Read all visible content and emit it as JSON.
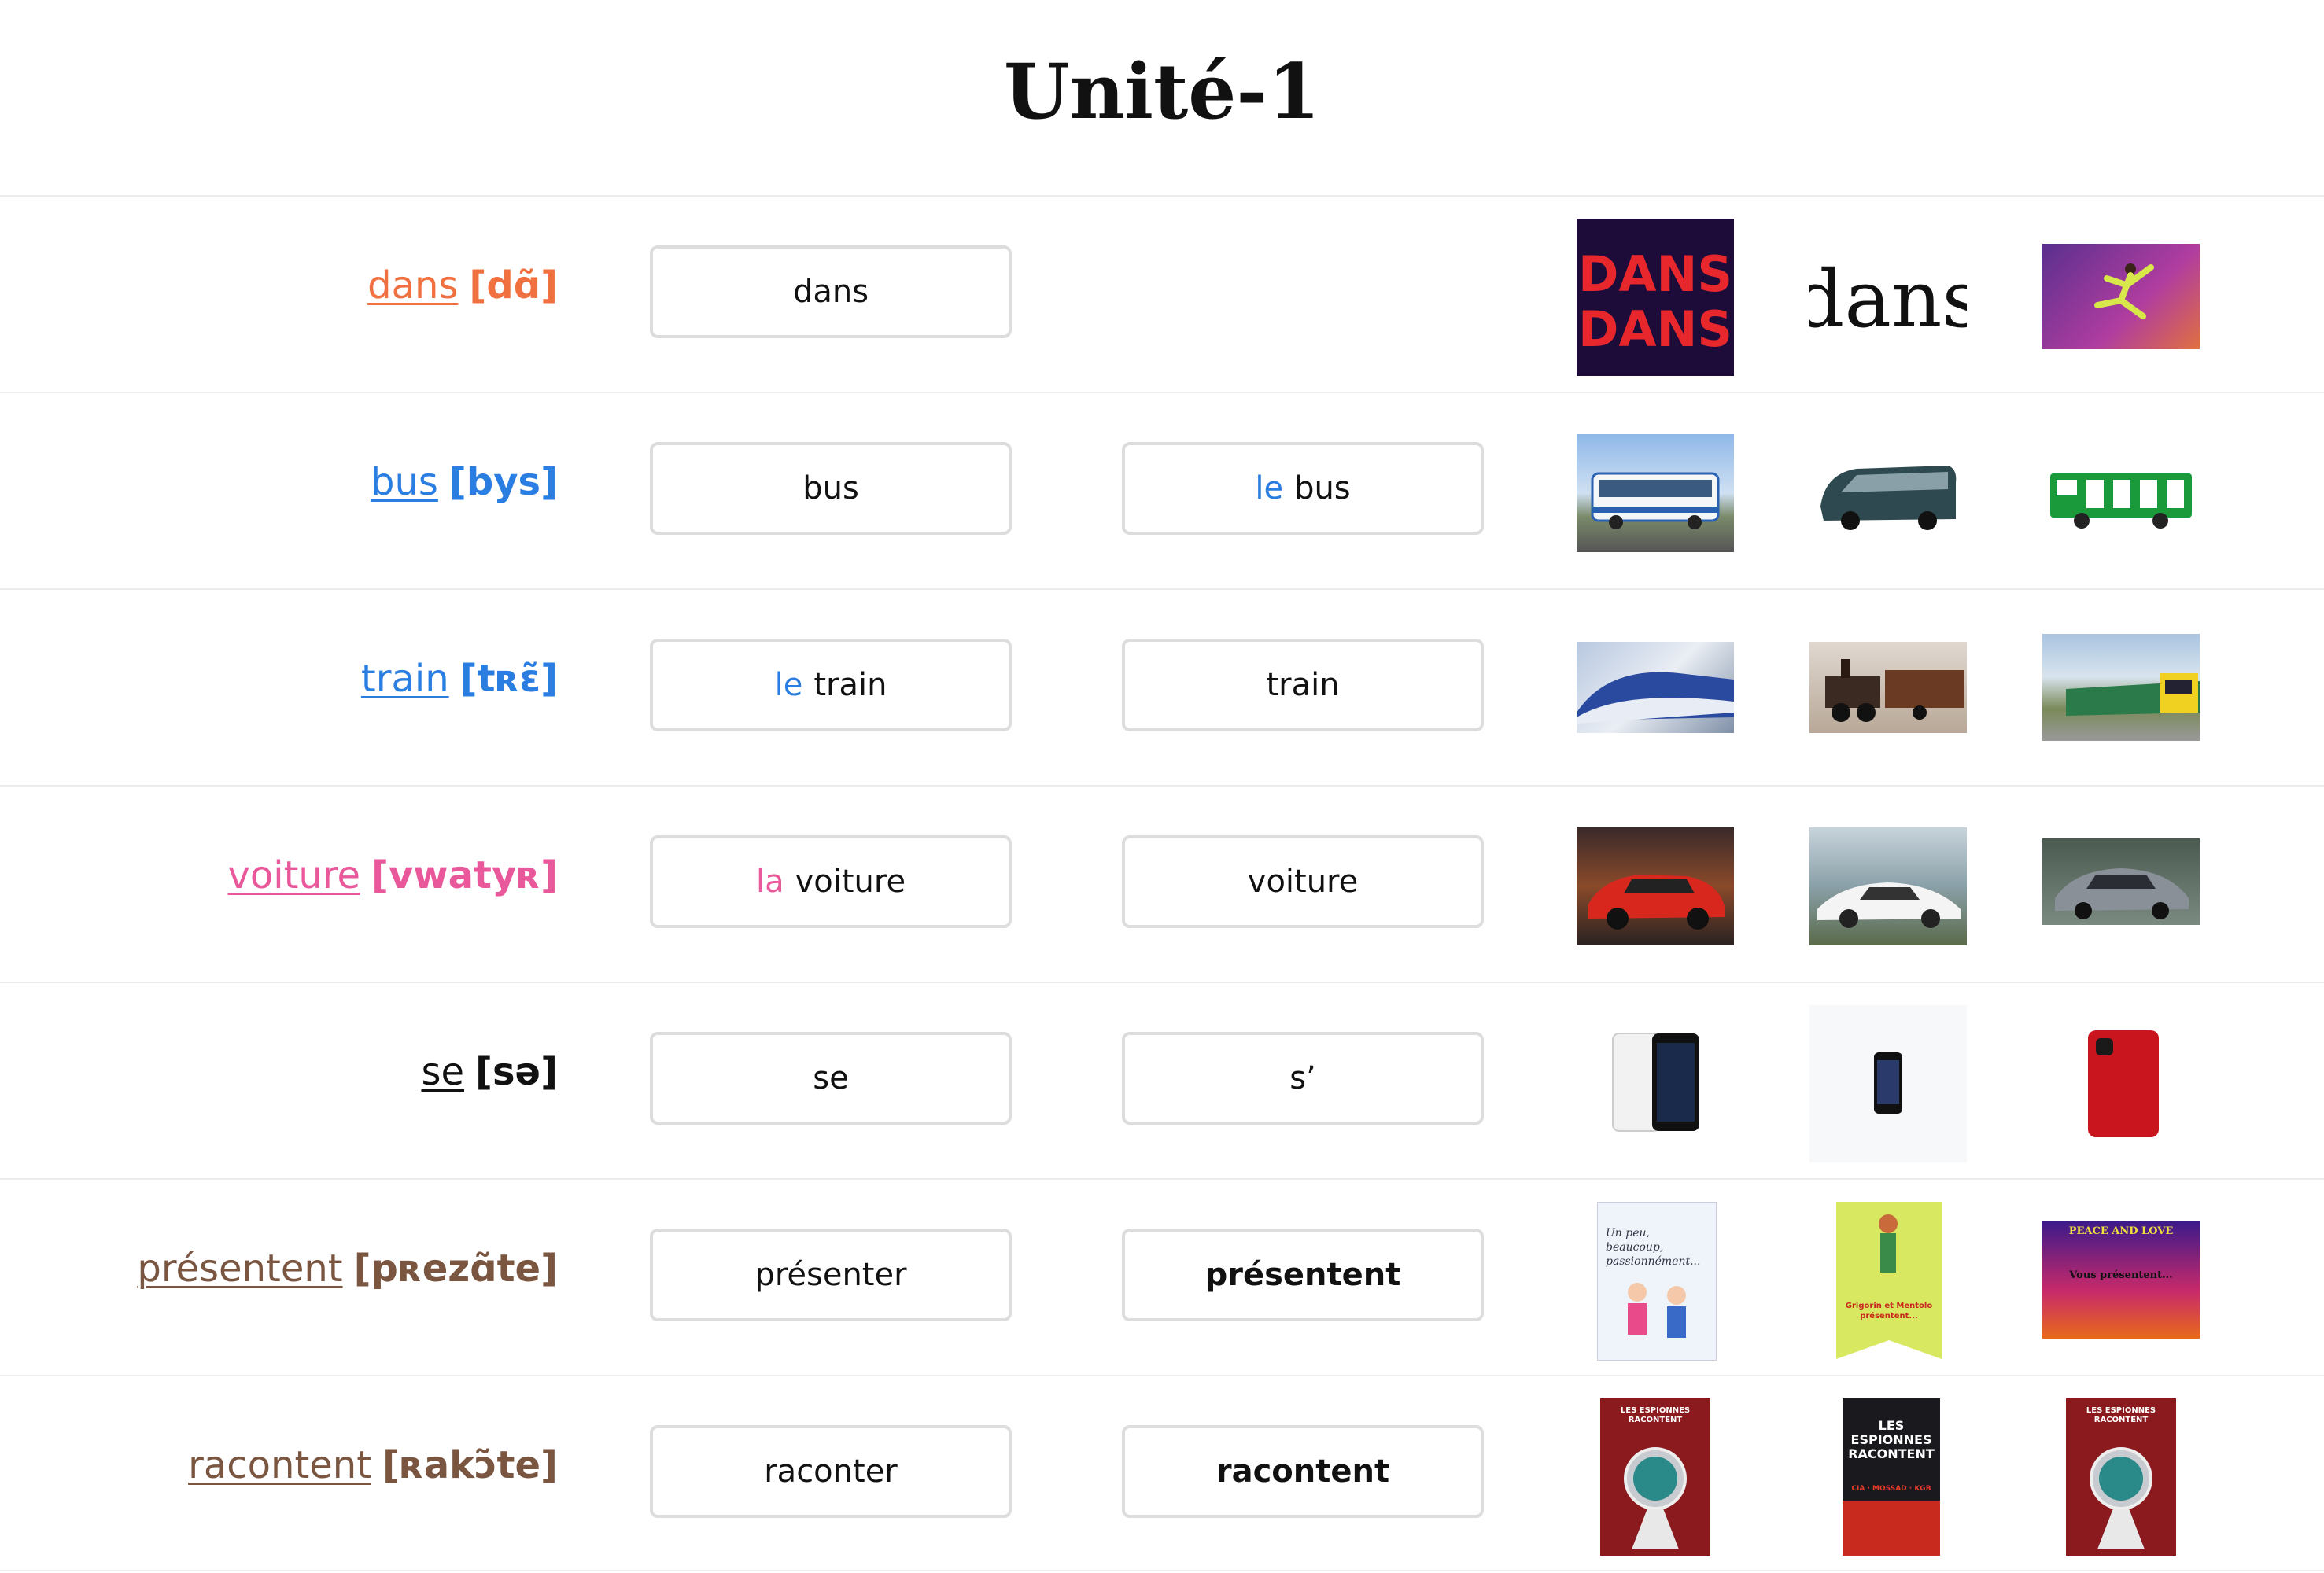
{
  "page": {
    "title": "Unité-1"
  },
  "rows": [
    {
      "word": "dans",
      "phon": "[dɑ̃]",
      "color": "#f07040",
      "choice1": {
        "article": "",
        "text": "dans"
      },
      "choice2": null,
      "images": [
        "dans-logo",
        "dans-word",
        "dancer-jump"
      ]
    },
    {
      "word": "bus",
      "phon": "[bys]",
      "color": "#2a7de1",
      "choice1": {
        "article": "",
        "text": "bus"
      },
      "choice2": {
        "article": "le",
        "text": "bus"
      },
      "images": [
        "city-bus",
        "coach-bus",
        "green-bus-icon"
      ]
    },
    {
      "word": "train",
      "phon": "[tʀɛ̃]",
      "color": "#2a7de1",
      "choice1": {
        "article": "le",
        "text": "train"
      },
      "choice2": {
        "article": "",
        "text": "train"
      },
      "images": [
        "high-speed-train",
        "steam-train",
        "commuter-train"
      ]
    },
    {
      "word": "voiture",
      "phon": "[vwatyʀ]",
      "color": "#e8589a",
      "choice1": {
        "article": "la",
        "text": "voiture"
      },
      "choice2": {
        "article": "",
        "text": "voiture"
      },
      "images": [
        "red-car",
        "white-supercar",
        "grey-car"
      ]
    },
    {
      "word": "se",
      "phon": "[sə]",
      "color": "#111111",
      "choice1": {
        "article": "",
        "text": "se"
      },
      "choice2": {
        "article": "",
        "text": "s’"
      },
      "images": [
        "white-phone",
        "black-phone",
        "red-phone"
      ]
    },
    {
      "word": "présentent",
      "phon": "[pʀezɑ̃te]",
      "color": "#7a5540",
      "choice1": {
        "article": "",
        "text": "présenter"
      },
      "choice2": {
        "article": "",
        "text": "présentent"
      },
      "images": [
        "comic-book-cover",
        "green-poster",
        "peace-and-love-cover"
      ]
    },
    {
      "word": "racontent",
      "phon": "[ʀakɔ̃te]",
      "color": "#7a5540",
      "choice1": {
        "article": "",
        "text": "raconter"
      },
      "choice2": {
        "article": "",
        "text": "racontent"
      },
      "images": [
        "espionnes-book-1",
        "espionnes-book-2",
        "espionnes-book-3"
      ]
    }
  ],
  "image_text": {
    "dans_logo": "DANS DANS",
    "dans_word": "dans",
    "comic_line": "Un peu, beaucoup, passionnément...",
    "green_poster": "Grigorin et Mentolo présentent...",
    "peace_love": "PEACE AND LOVE",
    "peace_vous": "Vous présentent...",
    "book_title": "LES ESPIONNES RACONTENT",
    "book_sub": "CIA · MOSSAD · KGB"
  },
  "article_colors": {
    "le": "#2a7de1",
    "la": "#e8589a"
  }
}
